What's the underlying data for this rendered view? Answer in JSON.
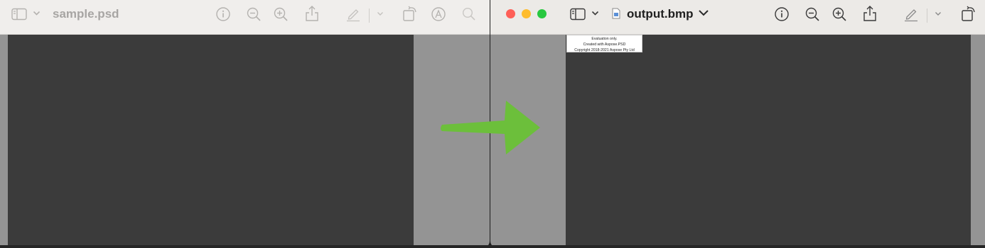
{
  "left_window": {
    "title": "sample.psd",
    "icons": [
      "sidebar-icon",
      "chevron-down-icon",
      "info-icon",
      "zoom-out-icon",
      "zoom-in-icon",
      "share-icon",
      "markup-pen-icon",
      "rotate-icon",
      "annotate-icon",
      "search-icon"
    ]
  },
  "right_window": {
    "title": "output.bmp",
    "icons": [
      "sidebar-icon",
      "chevron-down-icon",
      "file-icon",
      "info-icon",
      "zoom-out-icon",
      "zoom-in-icon",
      "share-icon",
      "markup-pen-icon",
      "rotate-icon"
    ],
    "watermark": {
      "line1": "Evaluation only.",
      "line2": "Created with Aspose.PSD",
      "line3": "Copyright 2018-2021 Aspose Pty Ltd"
    }
  },
  "colors": {
    "canvas": "#3b3b3b",
    "window_bg": "#949494",
    "toolbar": "#eceae7",
    "arrow": "#6cbf3b",
    "close": "#fe5f57",
    "minimize": "#febc2e",
    "zoom": "#28c840"
  }
}
